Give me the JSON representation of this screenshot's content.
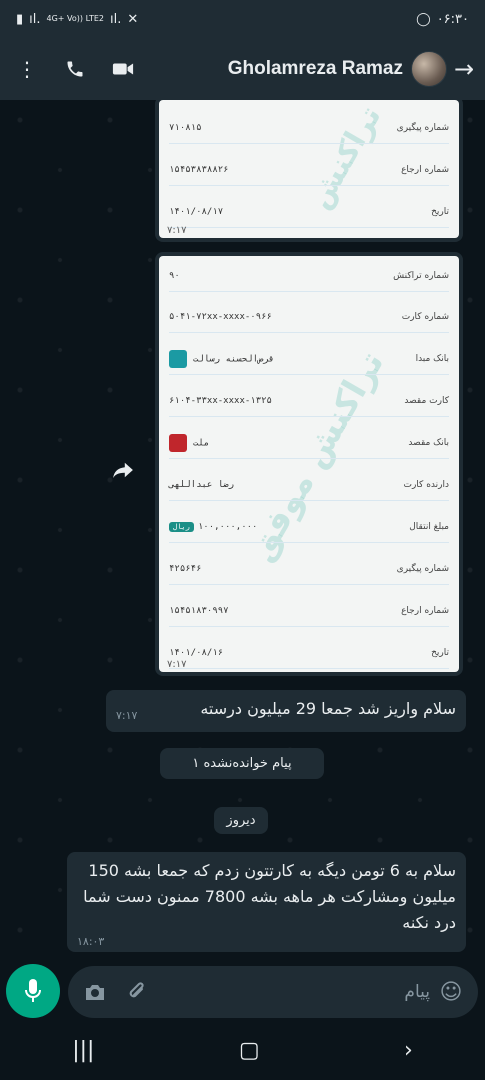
{
  "status_bar": {
    "time": "۰۶:۳۰",
    "network": "4G+ Vo)) LTE2",
    "icons": [
      "sim-icon",
      "signal-icon",
      "wifi-icon",
      "mute-icon",
      "whatsapp-icon"
    ]
  },
  "header": {
    "contact_name": "Gholamreza Ramaz",
    "icons": [
      "more-icon",
      "call-icon",
      "video-icon",
      "avatar",
      "back-arrow-icon"
    ]
  },
  "receipt_top": {
    "rows": [
      {
        "label": "شماره پیگیری",
        "value": "۷۱۰۸۱۵"
      },
      {
        "label": "شماره ارجاع",
        "value": "۱۵۴۵۳۸۳۸۸۲۶"
      },
      {
        "label": "تاریخ",
        "value": "۱۴۰۱/۰۸/۱۷"
      }
    ],
    "time": "۷:۱۷",
    "watermark": "تراکنش"
  },
  "receipt_main": {
    "rows": [
      {
        "label": "شماره تراکنش",
        "value": "۹۰"
      },
      {
        "label": "شماره کارت",
        "value": "۵۰۴۱-۷۲xx-xxxx-۰۹۶۶"
      },
      {
        "label": "بانک مبدا",
        "value": "قرض‌الحسنه رسالت"
      },
      {
        "label": "کارت مقصد",
        "value": "۶۱۰۴-۳۳xx-xxxx-۱۳۲۵"
      },
      {
        "label": "بانک مقصد",
        "value": "ملت"
      },
      {
        "label": "دارنده کارت",
        "value": "رضا  عبداللهی"
      },
      {
        "label": "مبلغ انتقال",
        "value": "۱۰۰,۰۰۰,۰۰۰"
      },
      {
        "label": "شماره پیگیری",
        "value": "۴۲۵۶۴۶"
      },
      {
        "label": "شماره ارجاع",
        "value": "۱۵۴۵۱۸۳۰۹۹۷"
      },
      {
        "label": "تاریخ",
        "value": "۱۴۰۱/۰۸/۱۶"
      }
    ],
    "currency_badge": "ریال",
    "time": "۷:۱۷",
    "watermark": "تراکنش موفق"
  },
  "messages": [
    {
      "text": "سلام واریز شد جمعا 29 میلیون درسته",
      "time": "۷:۱۷"
    },
    {
      "text": "سلام به 6 تومن دیگه به کارتتون زدم که جمعا بشه 150 میلیون ومشارکت هر ماهه بشه 7800 ممنون دست شما درد نکنه",
      "time": "۱۸:۰۳"
    }
  ],
  "chips": {
    "unread": "۱ پیام خوانده‌نشده",
    "date": "دیروز"
  },
  "composer": {
    "placeholder": "پیام",
    "icons": [
      "mic-icon",
      "camera-icon",
      "attach-icon",
      "emoji-icon"
    ]
  },
  "nav": {
    "icons": [
      "recent-apps-icon",
      "home-icon",
      "back-icon"
    ]
  }
}
